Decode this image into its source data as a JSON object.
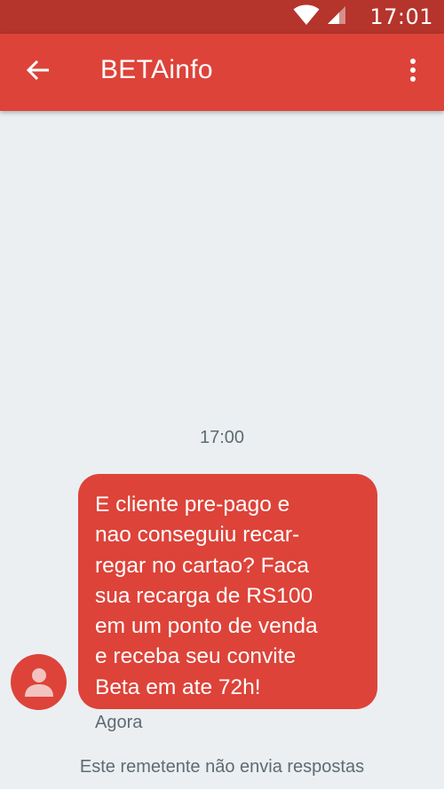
{
  "status_bar": {
    "time": "17:01",
    "icons": [
      "wifi-icon",
      "cell-signal-icon"
    ]
  },
  "app_bar": {
    "title": "BETAinfo",
    "back_icon": "arrow-back-icon",
    "menu_icon": "more-vert-icon"
  },
  "conversation": {
    "timestamp": "17:00",
    "message": {
      "text": "E cliente pre-pago e\nnao conseguiu recar-\nregar no cartao? Faca\nsua recarga de RS100\nem um ponto de venda\ne receba seu convite\nBeta em ate 72h!",
      "time_label": "Agora"
    },
    "sender_notice": "Este remetente não envia respostas"
  },
  "colors": {
    "status_bar": "#b5342b",
    "accent": "#dd4339",
    "background": "#ebeff2",
    "muted_text": "#5f6b72"
  }
}
